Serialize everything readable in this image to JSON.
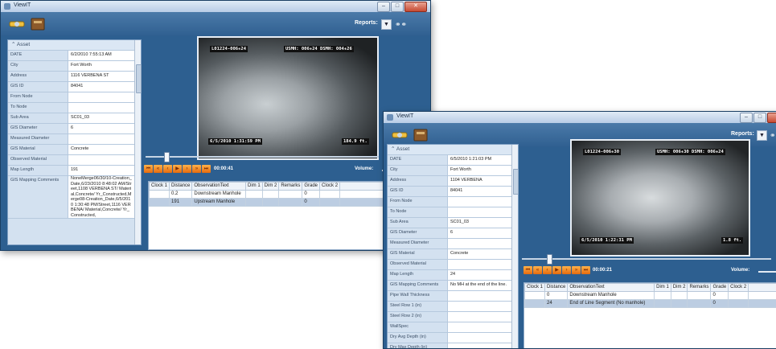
{
  "windows": [
    {
      "title": "ViewIT",
      "reports_label": "Reports:",
      "panel_header": "Asset",
      "asset_rows": [
        {
          "label": "DATE",
          "value": "6/2/2010 7:55:13 AM"
        },
        {
          "label": "City",
          "value": "Fort Worth"
        },
        {
          "label": "Address",
          "value": "1116 VERBENA ST"
        },
        {
          "label": "GIS ID",
          "value": "84041"
        },
        {
          "label": "From Node",
          "value": ""
        },
        {
          "label": "To Node",
          "value": ""
        },
        {
          "label": "Sub Area",
          "value": "SC01_03"
        },
        {
          "label": "GIS Diameter",
          "value": "6"
        },
        {
          "label": "Measured Diameter",
          "value": ""
        },
        {
          "label": "GIS Material",
          "value": "Concrete"
        },
        {
          "label": "Observed Material",
          "value": ""
        },
        {
          "label": "Map Length",
          "value": "191"
        },
        {
          "label": "GIS Mapping Comments",
          "value": "NoneMerge06/30/10-Creation_Date,6/23/2010 8:48:02 AM/Street,1108 VERBENA ST/ Material,Concrete/ Yr_Constructed,Merge08-Creation_Date,6/5/2010 1:30:48 PM/Street,1116 VERBENA/ Material,Concrete/ Yr_Constructed,"
        }
      ],
      "video_osd": {
        "top_left": "L01224-006+24",
        "top_right": "USMH: 006+24 DSMH: 004+26",
        "bottom_left": "6/5/2010 1:31:59 PM",
        "bottom_right": "184.9 ft."
      },
      "time": "00:00:41",
      "volume_label": "Volume:",
      "progress": 0.08,
      "obs_headers": [
        "Clock 1",
        "Distance",
        "ObservationText",
        "Dim 1",
        "Dim 2",
        "Remarks",
        "Grade",
        "Clock 2"
      ],
      "obs_rows": [
        {
          "clock1": "",
          "distance": "0.2",
          "text": "Downstream Manhole",
          "dim1": "",
          "dim2": "",
          "remarks": "",
          "grade": "0",
          "clock2": ""
        },
        {
          "clock1": "",
          "distance": "191",
          "text": "Upstream Manhole",
          "dim1": "",
          "dim2": "",
          "remarks": "",
          "grade": "0",
          "clock2": ""
        }
      ]
    },
    {
      "title": "ViewIT",
      "reports_label": "Reports:",
      "panel_header": "Asset",
      "asset_rows": [
        {
          "label": "DATE",
          "value": "6/5/2010 1:21:03 PM"
        },
        {
          "label": "City",
          "value": "Fort Worth"
        },
        {
          "label": "Address",
          "value": "1104 VERBENA"
        },
        {
          "label": "GIS ID",
          "value": "84041"
        },
        {
          "label": "From Node",
          "value": ""
        },
        {
          "label": "To Node",
          "value": ""
        },
        {
          "label": "Sub Area",
          "value": "SC01_03"
        },
        {
          "label": "GIS Diameter",
          "value": "6"
        },
        {
          "label": "Measured Diameter",
          "value": ""
        },
        {
          "label": "GIS Material",
          "value": "Concrete"
        },
        {
          "label": "Observed Material",
          "value": ""
        },
        {
          "label": "Map Length",
          "value": "24"
        },
        {
          "label": "GIS Mapping Comments",
          "value": "No MH at the end of the line."
        },
        {
          "label": "Pipe Wall Thickness",
          "value": ""
        },
        {
          "label": "Steel Row 1 (in)",
          "value": ""
        },
        {
          "label": "Steel Row 2 (in)",
          "value": ""
        },
        {
          "label": "WallSpec",
          "value": ""
        },
        {
          "label": "Dry Avg Depth (in)",
          "value": ""
        },
        {
          "label": "Dry Max Depth (in)",
          "value": ""
        }
      ],
      "video_osd": {
        "top_left": "L01224-006+30",
        "top_right": "USMH: 006+30 DSMH: 006+24",
        "bottom_left": "6/5/2010 1:22:31 PM",
        "bottom_right": "1.8 ft."
      },
      "time": "00:00:21",
      "volume_label": "Volume:",
      "progress": 0.1,
      "obs_headers": [
        "Clock 1",
        "Distance",
        "ObservationText",
        "Dim 1",
        "Dim 2",
        "Remarks",
        "Grade",
        "Clock 2"
      ],
      "obs_rows": [
        {
          "clock1": "",
          "distance": "0",
          "text": "Downstream Manhole",
          "dim1": "",
          "dim2": "",
          "remarks": "",
          "grade": "0",
          "clock2": ""
        },
        {
          "clock1": "",
          "distance": "24",
          "text": "End of Line Segment (No manhole)",
          "dim1": "",
          "dim2": "",
          "remarks": "",
          "grade": "0",
          "clock2": ""
        }
      ]
    }
  ],
  "playback_controls": [
    "first",
    "prev-chapter",
    "step-back",
    "play",
    "step-forward",
    "next-chapter",
    "last"
  ]
}
